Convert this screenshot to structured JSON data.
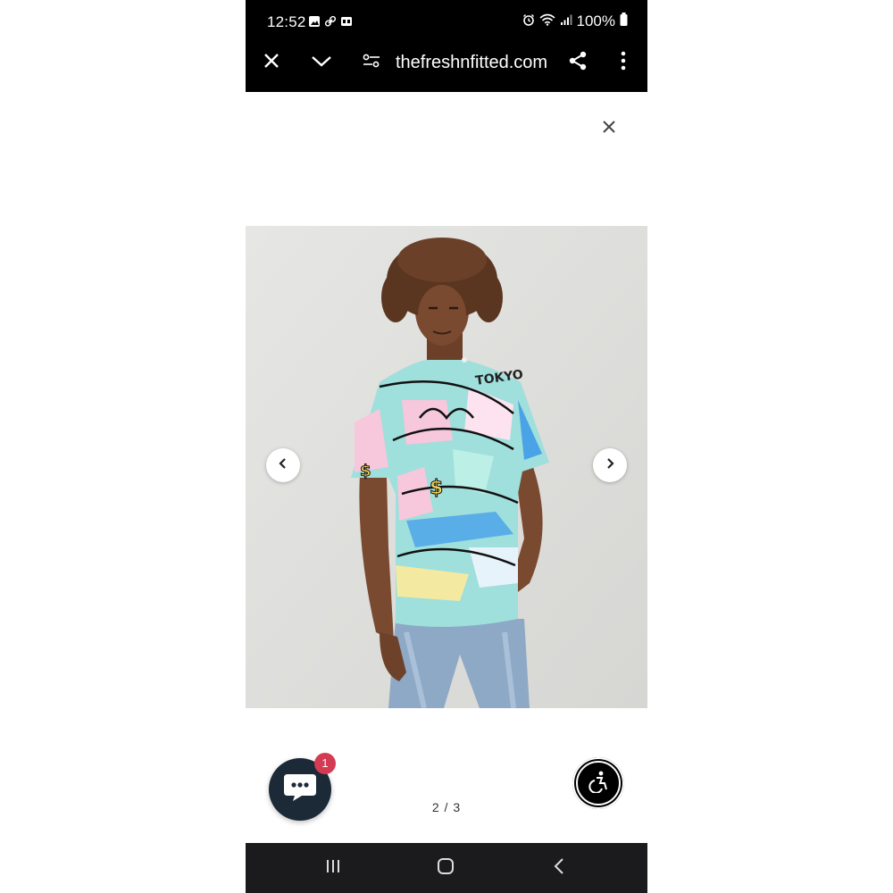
{
  "status_bar": {
    "time": "12:52",
    "battery": "100%",
    "icons": [
      "image-icon",
      "link-icon",
      "ge-icon",
      "alarm-icon",
      "wifi-icon",
      "signal-icon",
      "battery-icon"
    ]
  },
  "browser": {
    "url": "thefreshnfitted.com",
    "buttons": [
      "close-icon",
      "chevron-down-icon",
      "site-settings-icon",
      "share-icon",
      "more-icon"
    ]
  },
  "gallery": {
    "close_icon": "close-icon",
    "current_slide": 2,
    "total_slides": 3,
    "pager_label": "2 / 3",
    "prev_icon": "chevron-left-icon",
    "next_icon": "chevron-right-icon"
  },
  "chat_widget": {
    "badge_count": "1",
    "icon": "chat-bubble-icon",
    "color": "#1b2a36",
    "badge_color": "#d43b53"
  },
  "accessibility_widget": {
    "icon": "accessibility-icon"
  },
  "nav_bar": {
    "buttons": [
      "recents-icon",
      "home-icon",
      "back-icon"
    ]
  }
}
